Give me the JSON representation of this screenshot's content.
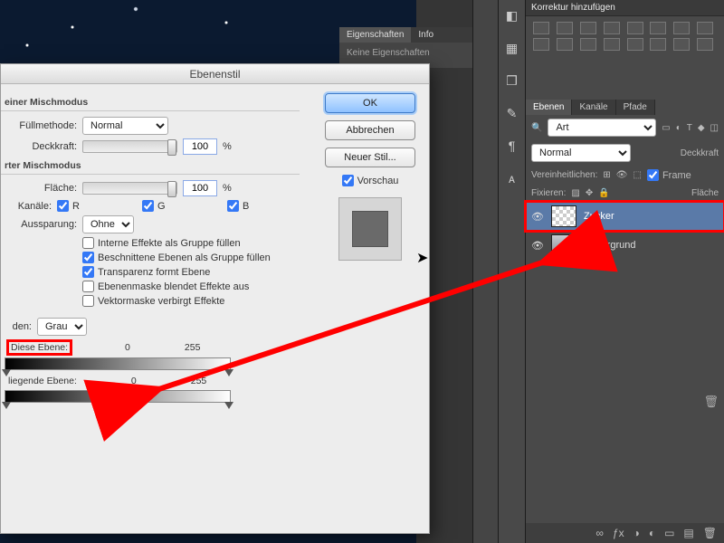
{
  "adjustments_title": "Korrektur hinzufügen",
  "props": {
    "tab1": "Eigenschaften",
    "tab2": "Info",
    "empty": "Keine Eigenschaften"
  },
  "layers": {
    "tab_layers": "Ebenen",
    "tab_channels": "Kanäle",
    "tab_paths": "Pfade",
    "filter": "Art",
    "blend_mode": "Normal",
    "opacity_label": "Deckkraft",
    "unify": "Vereinheitlichen:",
    "frame": "Frame",
    "lock": "Fixieren:",
    "fill_label": "Fläche",
    "layer1": "Zucker",
    "layer2": "Hintergrund"
  },
  "dialog": {
    "title": "Ebenenstil",
    "btn_ok": "OK",
    "btn_cancel": "Abbrechen",
    "btn_newstyle": "Neuer Stil...",
    "preview": "Vorschau",
    "sec1": "einer Mischmodus",
    "fill_method": "Füllmethode:",
    "fill_method_val": "Normal",
    "opacity": "Deckkraft:",
    "opacity_val": "100",
    "sec2": "rter Mischmodus",
    "area": "Fläche:",
    "area_val": "100",
    "channels": "Kanäle:",
    "ch_r": "R",
    "ch_g": "G",
    "ch_b": "B",
    "knockout": "Aussparung:",
    "knockout_val": "Ohne",
    "o1": "Interne Effekte als Gruppe füllen",
    "o2": "Beschnittene Ebenen als Gruppe füllen",
    "o3": "Transparenz formt Ebene",
    "o4": "Ebenenmaske blendet Effekte aus",
    "o5": "Vektormaske verbirgt Effekte",
    "blendif_label": "den:",
    "blendif_val": "Grau",
    "this_layer": "Diese Ebene:",
    "this_lo": "0",
    "this_hi": "255",
    "under_layer": "liegende Ebene:",
    "under_lo": "0",
    "under_hi": "255",
    "pct": "%"
  }
}
